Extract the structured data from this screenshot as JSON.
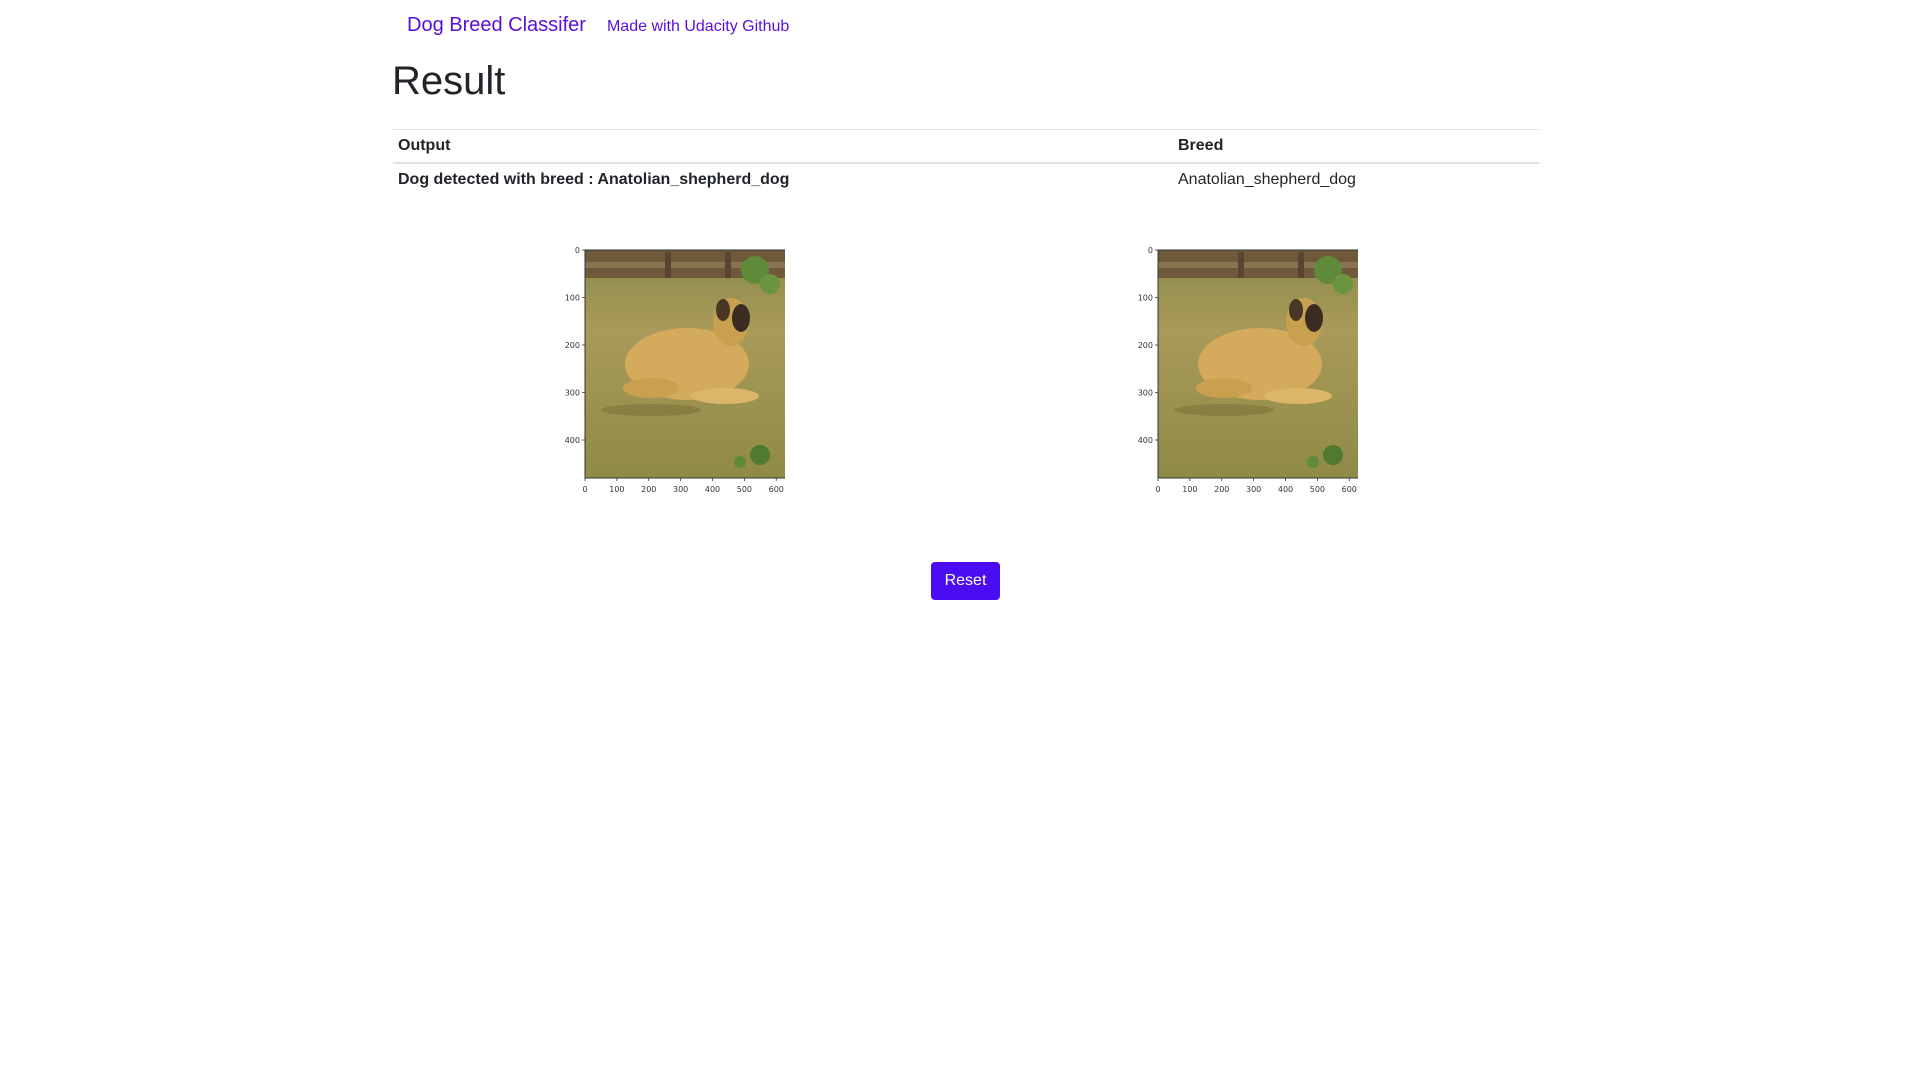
{
  "nav": {
    "brand": "Dog Breed Classifer",
    "link": "Made with Udacity Github"
  },
  "page": {
    "title": "Result"
  },
  "table": {
    "headers": [
      "Output",
      "Breed"
    ],
    "rows": [
      {
        "output": "Dog detected with breed : Anatolian_shepherd_dog",
        "breed": "Anatolian_shepherd_dog"
      }
    ]
  },
  "plots": [
    {
      "x_ticks": [
        "0",
        "100",
        "200",
        "300",
        "400",
        "500",
        "600"
      ],
      "y_ticks": [
        "0",
        "100",
        "200",
        "300",
        "400"
      ]
    },
    {
      "x_ticks": [
        "0",
        "100",
        "200",
        "300",
        "400",
        "500",
        "600"
      ],
      "y_ticks": [
        "0",
        "100",
        "200",
        "300",
        "400"
      ]
    }
  ],
  "actions": {
    "reset_label": "Reset"
  },
  "colors": {
    "accent": "#5a0fd8",
    "button": "#4a0cf0"
  }
}
